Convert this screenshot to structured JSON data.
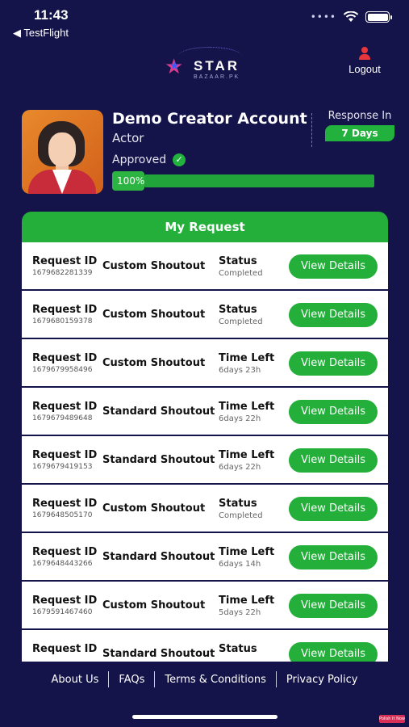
{
  "status_bar": {
    "time": "11:43",
    "back_app": "◀ TestFlight",
    "signal": "••••",
    "wifi_icon": "wifi-icon",
    "battery_icon": "battery-icon"
  },
  "header": {
    "logo_text": "STAR",
    "logo_sub": "BAZAAR.PK",
    "logout_label": "Logout",
    "logout_icon": "user-icon",
    "logout_icon_color": "#e8363b"
  },
  "profile": {
    "name": "Demo Creator Account",
    "role": "Actor",
    "approved_label": "Approved",
    "progress_percent": 100,
    "progress_label": "100%",
    "response_label": "Response In",
    "response_value": "7 Days"
  },
  "requests": {
    "title": "My Request",
    "rows": [
      {
        "id_label": "Request ID",
        "id": "1679682281339",
        "type": "Custom Shoutout",
        "status_label": "Status",
        "status_value": "Completed",
        "button": "View Details"
      },
      {
        "id_label": "Request ID",
        "id": "1679680159378",
        "type": "Custom Shoutout",
        "status_label": "Status",
        "status_value": "Completed",
        "button": "View Details"
      },
      {
        "id_label": "Request ID",
        "id": "1679679958496",
        "type": "Custom Shoutout",
        "status_label": "Time Left",
        "status_value": "6days 23h",
        "button": "View Details"
      },
      {
        "id_label": "Request ID",
        "id": "1679679489648",
        "type": "Standard Shoutout",
        "status_label": "Time Left",
        "status_value": "6days 22h",
        "button": "View Details"
      },
      {
        "id_label": "Request ID",
        "id": "1679679419153",
        "type": "Standard Shoutout",
        "status_label": "Time Left",
        "status_value": "6days 22h",
        "button": "View Details"
      },
      {
        "id_label": "Request ID",
        "id": "1679648505170",
        "type": "Custom Shoutout",
        "status_label": "Status",
        "status_value": "Completed",
        "button": "View Details"
      },
      {
        "id_label": "Request ID",
        "id": "1679648443266",
        "type": "Standard Shoutout",
        "status_label": "Time Left",
        "status_value": "6days 14h",
        "button": "View Details"
      },
      {
        "id_label": "Request ID",
        "id": "1679591467460",
        "type": "Custom Shoutout",
        "status_label": "Time Left",
        "status_value": "5days 22h",
        "button": "View Details"
      },
      {
        "id_label": "Request ID",
        "id": "",
        "type": "Standard Shoutout",
        "status_label": "Status",
        "status_value": "",
        "button": "View Details"
      }
    ]
  },
  "footer": {
    "links": [
      "About Us",
      "FAQs",
      "Terms & Conditions",
      "Privacy Policy"
    ]
  },
  "watermark": "Polish It Now",
  "colors": {
    "background": "#14134a",
    "accent_green": "#24ae3a",
    "logout_red": "#e8363b"
  }
}
